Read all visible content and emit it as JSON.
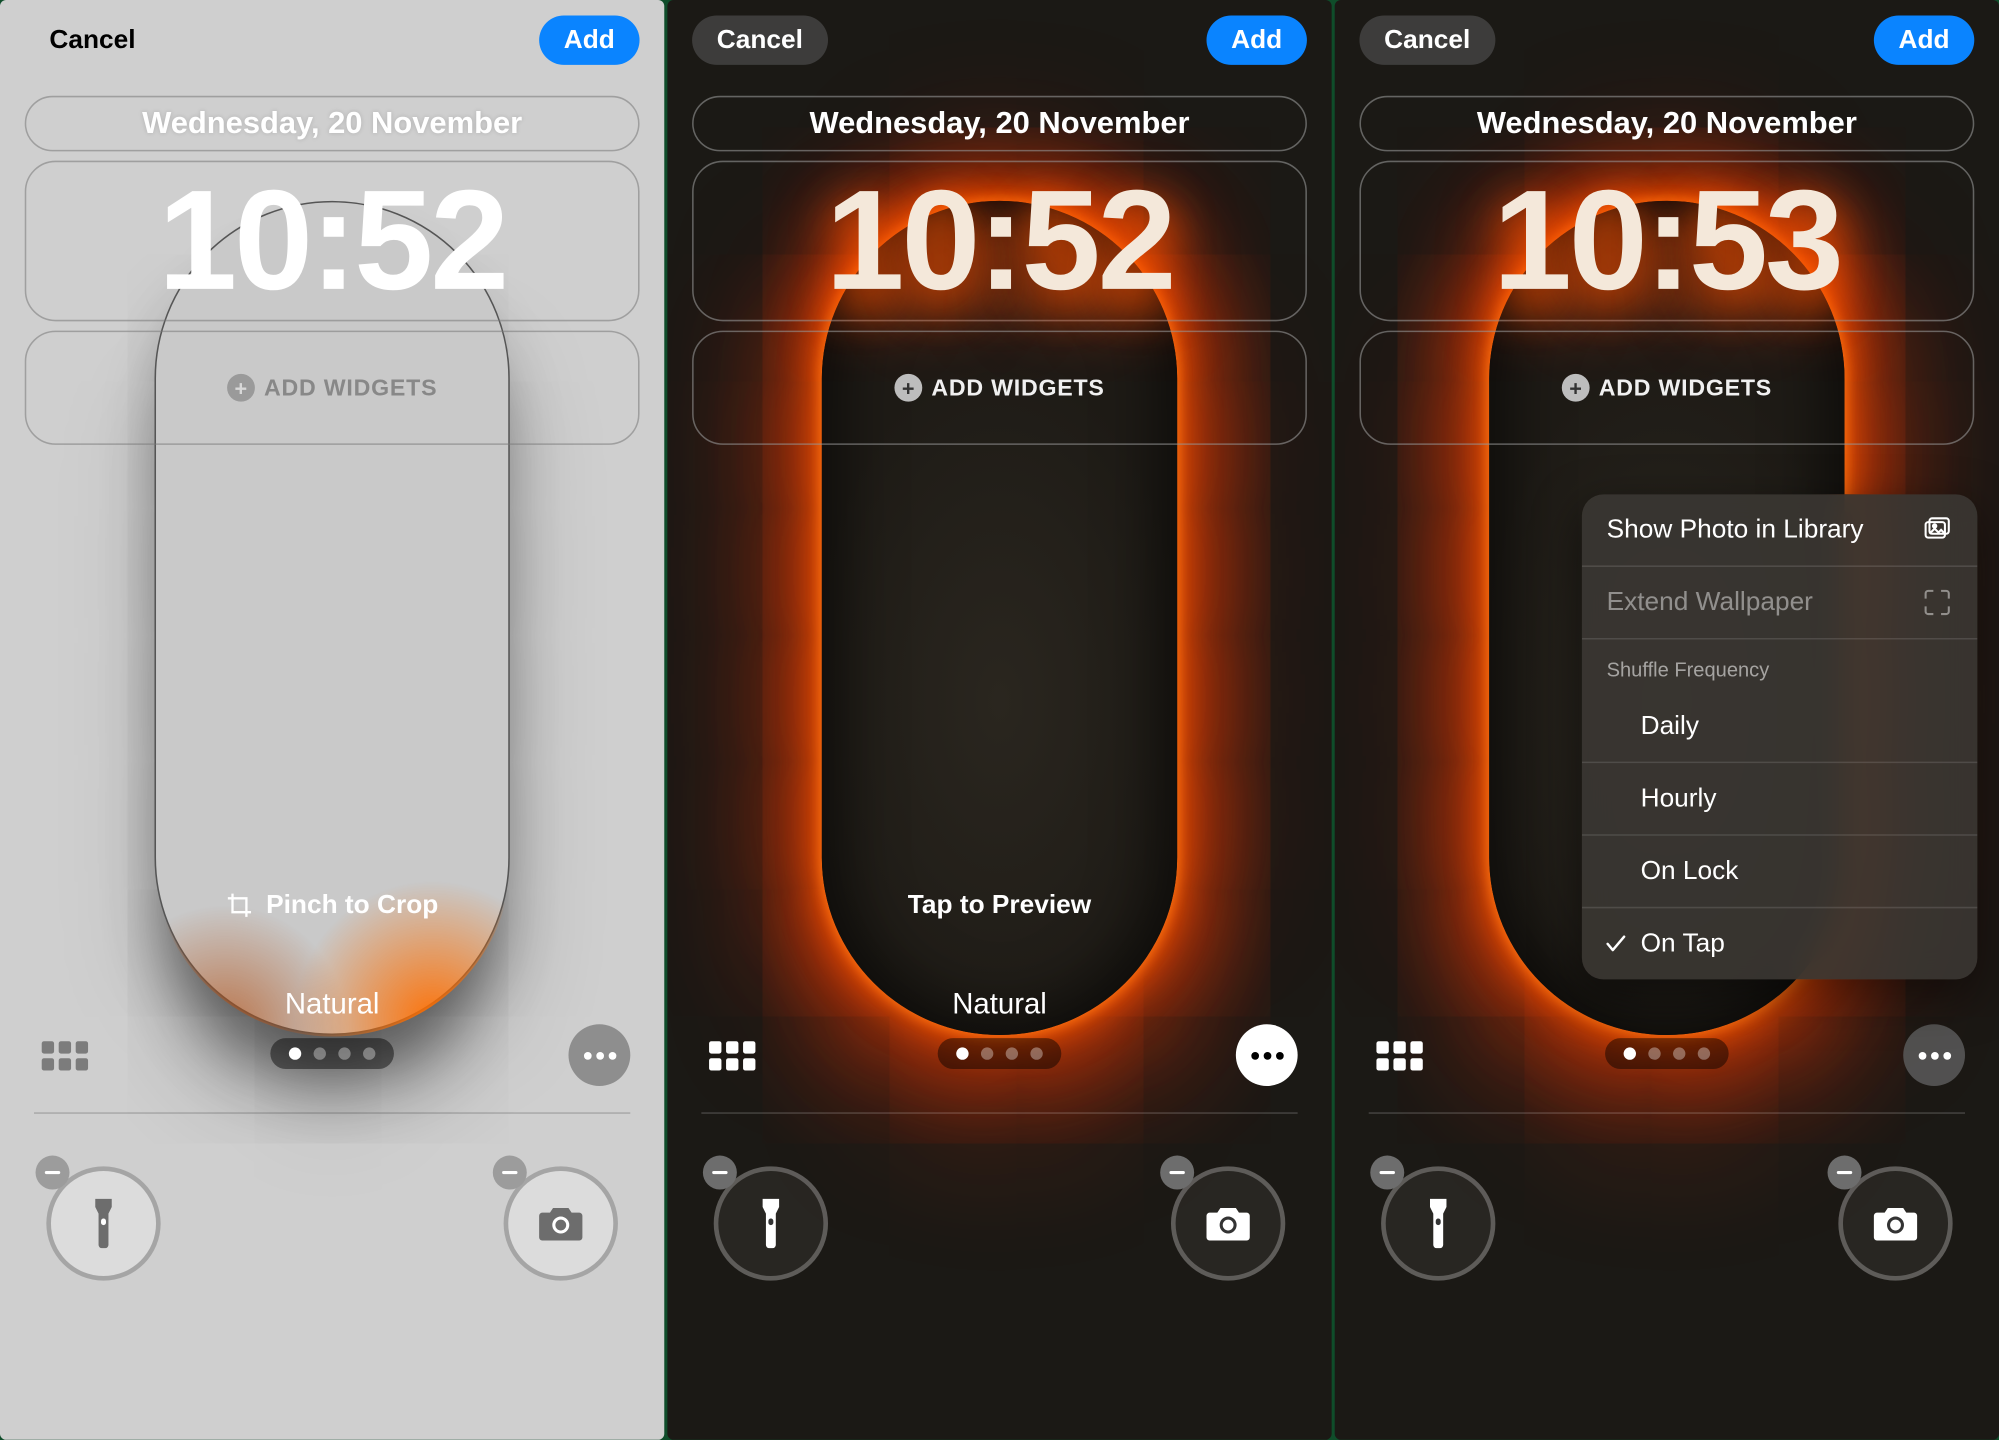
{
  "common": {
    "cancel": "Cancel",
    "add": "Add",
    "date": "Wednesday, 20 November",
    "addWidgets": "ADD WIDGETS",
    "filter": "Natural"
  },
  "panel1": {
    "time": "10:52",
    "hint": "Pinch to Crop"
  },
  "panel2": {
    "time": "10:52",
    "hint": "Tap to Preview"
  },
  "panel3": {
    "time": "10:53"
  },
  "menu": {
    "showPhoto": "Show Photo in Library",
    "extend": "Extend Wallpaper",
    "shuffleHeader": "Shuffle Frequency",
    "daily": "Daily",
    "hourly": "Hourly",
    "onLock": "On Lock",
    "onTap": "On Tap"
  }
}
